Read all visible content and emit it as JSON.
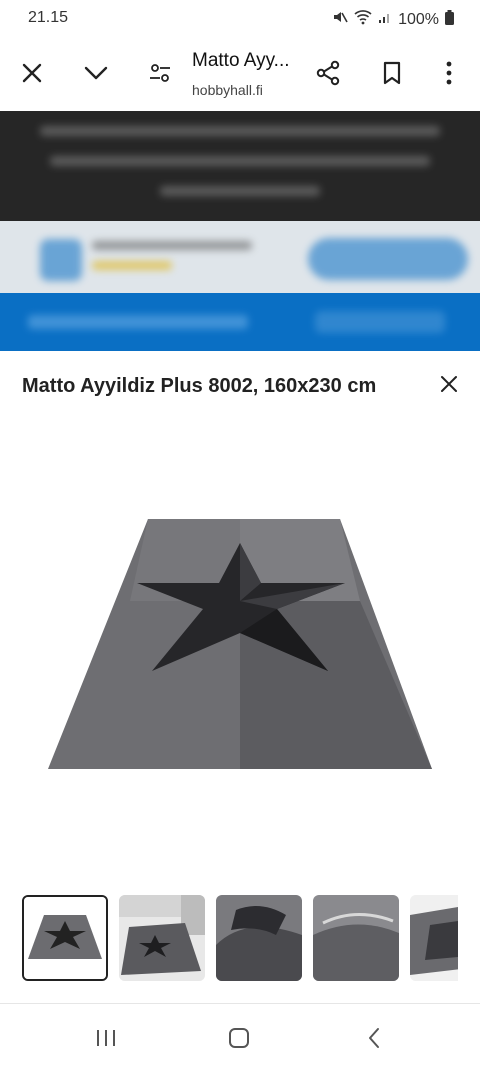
{
  "status_bar": {
    "time": "21.15",
    "battery": "100%"
  },
  "toolbar": {
    "title": "Matto Ayy...",
    "url": "hobbyhall.fi",
    "icons": [
      "close-icon",
      "chevron-down-icon",
      "settings-sliders-icon",
      "share-icon",
      "bookmark-icon",
      "more-vert-icon"
    ]
  },
  "sheet": {
    "title": "Matto Ayyildiz Plus 8002, 160x230 cm",
    "thumbnails": [
      "rug-front",
      "rug-room",
      "rug-edge-curl",
      "rug-texture",
      "rug-corner"
    ],
    "selected_thumbnail": 0
  },
  "colors": {
    "blue_bar": "#0a6fc4",
    "dark_bar": "#262626"
  },
  "system_nav": [
    "recent-apps-icon",
    "home-icon",
    "back-icon"
  ]
}
